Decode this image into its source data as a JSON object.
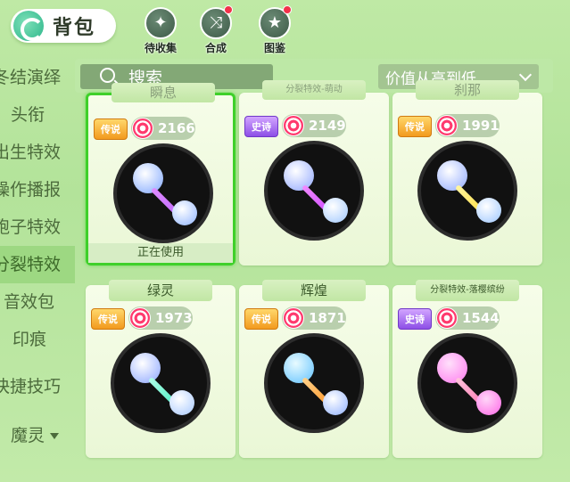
{
  "header": {
    "bag_title": "背包",
    "icons": [
      {
        "label": "待收集",
        "icon": "sparkle-icon",
        "dot": false
      },
      {
        "label": "合成",
        "icon": "shuffle-icon",
        "dot": true
      },
      {
        "label": "图鉴",
        "icon": "book-icon",
        "dot": true
      }
    ]
  },
  "search": {
    "label": "搜索"
  },
  "sort": {
    "selected": "价值从高到低"
  },
  "sidebar": {
    "items": [
      {
        "label": "冬结演绎"
      },
      {
        "label": "头衔"
      },
      {
        "label": "出生特效"
      },
      {
        "label": "操作播报"
      },
      {
        "label": "孢子特效"
      },
      {
        "label": "分裂特效",
        "active": true
      },
      {
        "label": "音效包"
      },
      {
        "label": "印痕"
      },
      {
        "label": "快捷技巧"
      },
      {
        "label": "魔灵"
      }
    ]
  },
  "cards": [
    {
      "name": "瞬息",
      "rarity": "传说",
      "rarity_type": "legend",
      "value": "2166",
      "in_use_label": "正在使用",
      "selected": true,
      "colors": {
        "b1": "#7ea6ff",
        "b2": "#8fb4ff",
        "trail": "#c26bff"
      }
    },
    {
      "name": "分裂特效-萌动",
      "rarity": "史诗",
      "rarity_type": "epic",
      "value": "2149",
      "selected": false,
      "colors": {
        "b1": "#8fa6ff",
        "b2": "#a0c8ff",
        "trail": "#d04dff"
      }
    },
    {
      "name": "刹那",
      "rarity": "传说",
      "rarity_type": "legend",
      "value": "1991",
      "selected": false,
      "colors": {
        "b1": "#8ea8ff",
        "b2": "#9cc6ff",
        "trail": "#ffe04a"
      }
    },
    {
      "name": "绿灵",
      "rarity": "传说",
      "rarity_type": "legend",
      "value": "1973",
      "selected": false,
      "colors": {
        "b1": "#8aa4ff",
        "b2": "#a6c8ff",
        "trail": "#52f0c8"
      }
    },
    {
      "name": "辉煌",
      "rarity": "传说",
      "rarity_type": "legend",
      "value": "1871",
      "selected": false,
      "colors": {
        "b1": "#5ec0ff",
        "b2": "#8fb0ff",
        "trail": "#ff9a2e"
      }
    },
    {
      "name": "分裂特效-落樱缤纷",
      "rarity": "史诗",
      "rarity_type": "epic",
      "value": "1544",
      "selected": false,
      "colors": {
        "b1": "#ff78ee",
        "b2": "#ff66e6",
        "trail": "#ff7fb6"
      }
    }
  ]
}
